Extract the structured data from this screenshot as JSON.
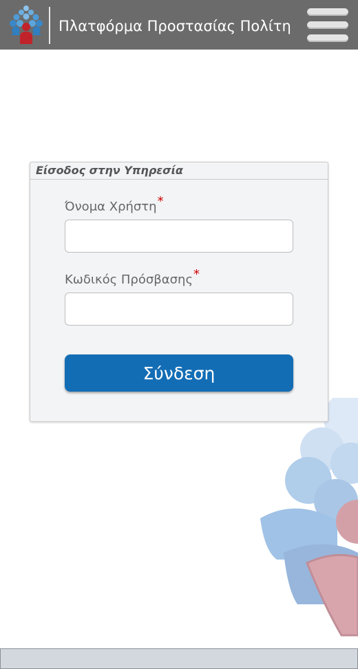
{
  "header": {
    "title": "Πλατφόρμα Προστασίας Πολίτη",
    "logo_icon": "civil-protection-people-logo",
    "menu_icon": "hamburger-menu-icon",
    "background_color": "#6b6b6b"
  },
  "login": {
    "legend": "Είσοδος στην Υπηρεσία",
    "username_label": "Όνομα Χρήστη",
    "username_value": "",
    "password_label": "Κωδικός Πρόσβασης",
    "password_value": "",
    "required_marker": "*",
    "submit_label": "Σύνδεση"
  },
  "colors": {
    "accent": "#136db5",
    "required": "#cc0000",
    "footer": "#d3d8df"
  }
}
